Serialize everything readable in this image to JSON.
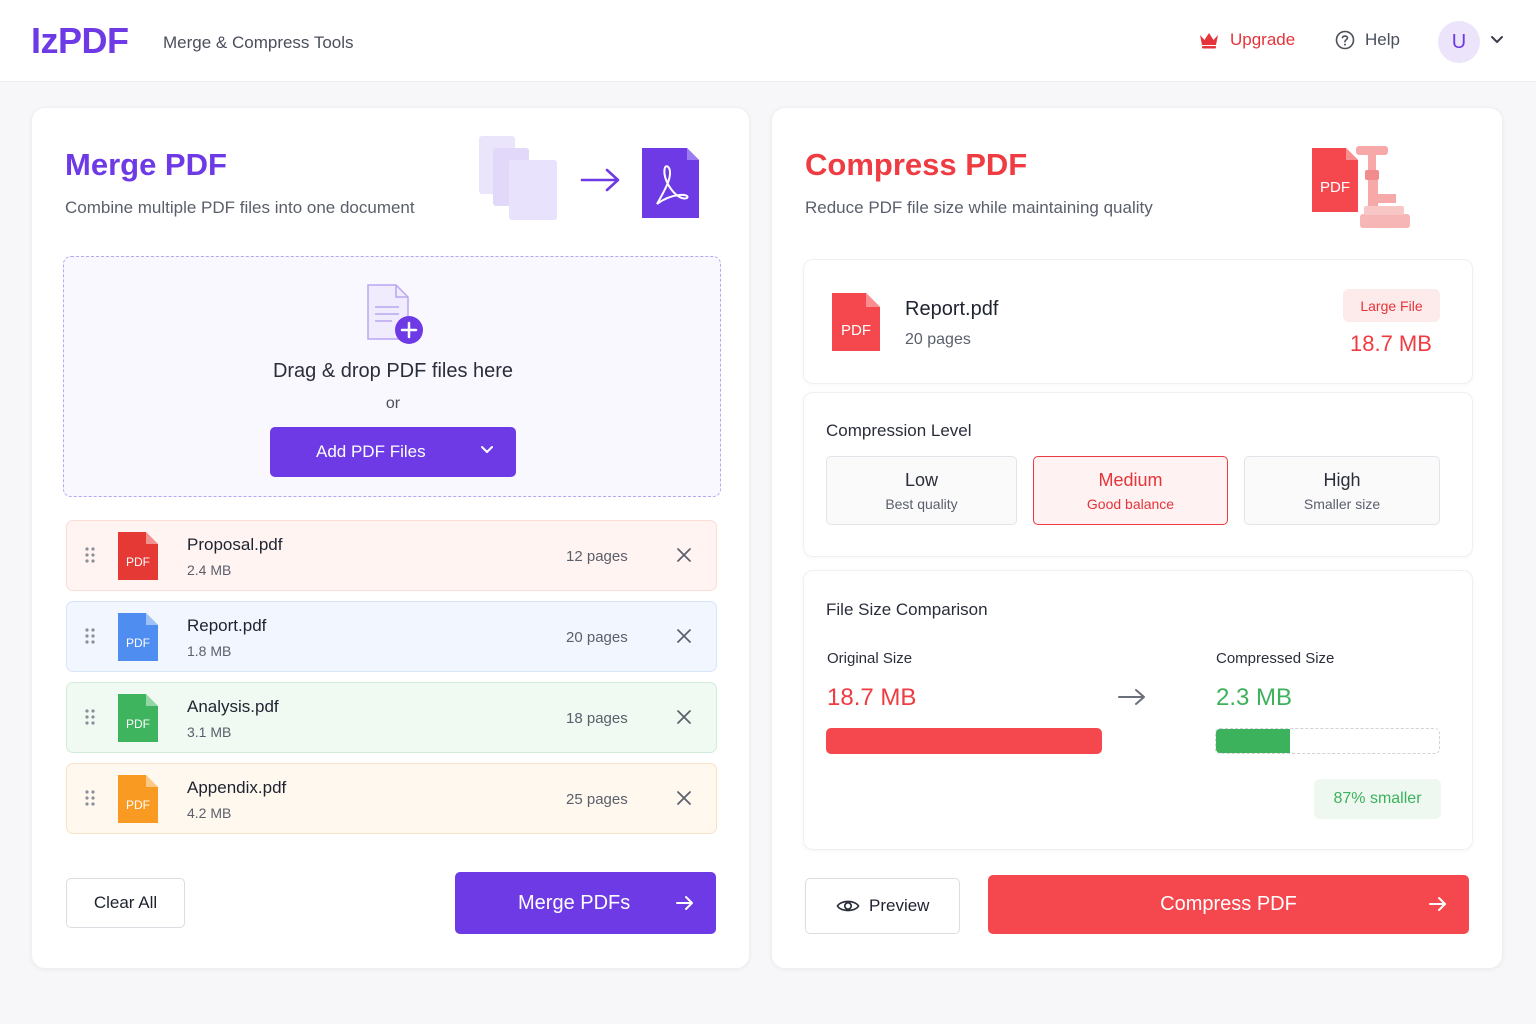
{
  "header": {
    "logo": "IzPDF",
    "tagline": "Merge & Compress Tools",
    "upgrade_label": "Upgrade",
    "help_label": "Help",
    "avatar_initial": "U"
  },
  "merge": {
    "title": "Merge PDF",
    "subtitle": "Combine multiple PDF files into one document",
    "dropzone": {
      "title": "Drag & drop PDF files here",
      "or": "or",
      "add_button": "Add PDF Files"
    },
    "files": [
      {
        "name": "Proposal.pdf",
        "size": "2.4 MB",
        "pages": "12 pages",
        "icon_label": "PDF",
        "color": "#e53935",
        "row_bg": "#fff4f2",
        "row_border": "#fbdcd6"
      },
      {
        "name": "Report.pdf",
        "size": "1.8 MB",
        "pages": "20 pages",
        "icon_label": "PDF",
        "color": "#4f8ef0",
        "row_bg": "#f1f6ff",
        "row_border": "#d7e5fb"
      },
      {
        "name": "Analysis.pdf",
        "size": "3.1 MB",
        "pages": "18 pages",
        "icon_label": "PDF",
        "color": "#3fb45e",
        "row_bg": "#f0f9f2",
        "row_border": "#d3ecd9"
      },
      {
        "name": "Appendix.pdf",
        "size": "4.2 MB",
        "pages": "25 pages",
        "icon_label": "PDF",
        "color": "#f99b22",
        "row_bg": "#fff8ee",
        "row_border": "#f9e3c5"
      }
    ],
    "clear_label": "Clear All",
    "merge_label": "Merge PDFs"
  },
  "compress": {
    "title": "Compress PDF",
    "subtitle": "Reduce PDF file size while maintaining quality",
    "hero_icon_label": "PDF",
    "file": {
      "name": "Report.pdf",
      "pages": "20 pages",
      "icon_label": "PDF",
      "badge": "Large File",
      "size": "18.7 MB"
    },
    "level_heading": "Compression Level",
    "levels": [
      {
        "name": "Low",
        "desc": "Best quality"
      },
      {
        "name": "Medium",
        "desc": "Good balance"
      },
      {
        "name": "High",
        "desc": "Smaller size"
      }
    ],
    "selected_level": "Medium",
    "comparison": {
      "heading": "File Size Comparison",
      "original_label": "Original Size",
      "original_value": "18.7 MB",
      "compressed_label": "Compressed Size",
      "compressed_value": "2.3 MB",
      "compressed_fraction": 0.33,
      "saving": "87% smaller"
    },
    "preview_label": "Preview",
    "compress_label": "Compress PDF"
  },
  "colors": {
    "brand_purple": "#6d3ae6",
    "brand_red": "#ef3b42",
    "success_green": "#3db25c"
  }
}
